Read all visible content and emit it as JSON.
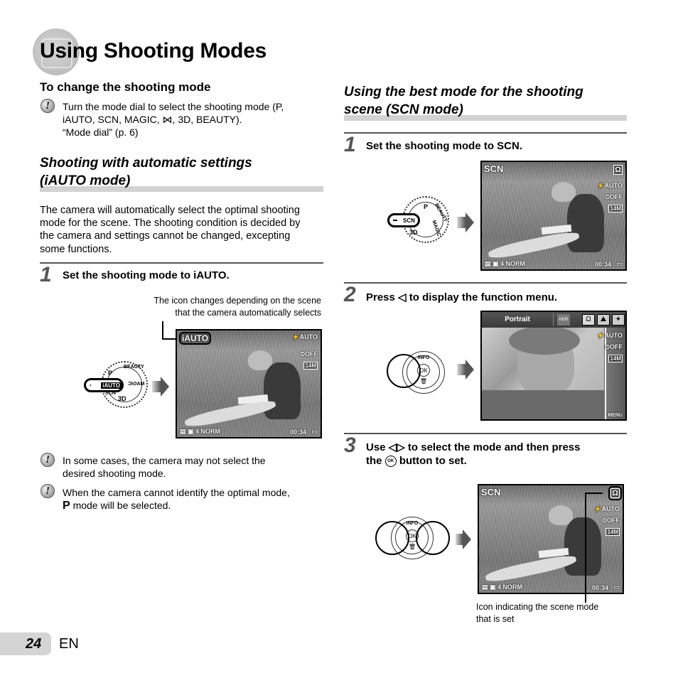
{
  "page": {
    "title": "Using Shooting Modes",
    "number": "24",
    "language": "EN"
  },
  "change_mode": {
    "heading": "To change the shooting mode",
    "note_line1": "Turn the mode dial to select the shooting mode (P,",
    "note_line2": "iAUTO, SCN, MAGIC, ⋈, 3D, BEAUTY).",
    "note_line3": "“Mode dial” (p. 6)"
  },
  "iauto_section": {
    "heading_line1": "Shooting with automatic settings",
    "heading_line2": "(iAUTO mode)",
    "body": [
      "The camera will automatically select the optimal shooting",
      "mode for the scene. The shooting condition is decided by",
      "the camera and settings cannot be changed, excepting",
      "some functions."
    ],
    "step1": {
      "number": "1",
      "text": "Set the shooting mode to iAUTO."
    },
    "callout_line1": "The icon changes depending on the scene",
    "callout_line2": "that the camera automatically selects",
    "dial": {
      "selected": "iAUTO",
      "labels": [
        "P",
        "BEAUTY",
        "MAGIC",
        "3D",
        "SCN"
      ]
    },
    "screen": {
      "mode_icon": "iAUTO",
      "flash": "⚡AUTO",
      "timer": "⏲OFF",
      "size": "14M",
      "bottom_left": "▤ ▣ 4 NORM",
      "time": "00:34",
      "battery": "▭"
    },
    "notes": [
      {
        "line1": "In some cases, the camera may not select the",
        "line2": "desired shooting mode."
      },
      {
        "line1": "When the camera cannot identify the optimal mode,",
        "line2": "mode will be selected.",
        "prefix": "P"
      }
    ]
  },
  "scn_section": {
    "heading_line1": "Using the best mode for the shooting",
    "heading_line2": "scene (SCN mode)",
    "step1": {
      "number": "1",
      "text": "Set the shooting mode to SCN."
    },
    "dial1": {
      "selected": "SCN",
      "labels": [
        "P",
        "BEAUTY",
        "MAGIC",
        "3D"
      ]
    },
    "screen1": {
      "mode_icon": "SCN",
      "scene_icon": "Ω",
      "flash": "⚡AUTO",
      "timer": "⏲OFF",
      "size": "14M",
      "bottom_left": "▤ ▣ 4 NORM",
      "time": "00:34",
      "battery": "▭"
    },
    "step2": {
      "number": "2",
      "text": "Press ◁ to display the function menu."
    },
    "dpad2": {
      "top": "INFO",
      "center": "OK",
      "bottom": "🗑"
    },
    "menu_screen": {
      "mode_label": "Portrait",
      "icons": [
        "HDR",
        "Ω",
        "⛰",
        "✦"
      ],
      "flash": "⚡AUTO",
      "timer": "⏲OFF",
      "size": "14M",
      "menu": "MENU"
    },
    "step3": {
      "number": "3",
      "line1": "Use ◁▷ to select the mode and then press",
      "line2_pre": "the",
      "ok": "OK",
      "line2_post": "button to set."
    },
    "dpad3": {
      "top": "INFO",
      "center": "OK",
      "bottom": "🗑"
    },
    "screen3": {
      "mode_icon": "SCN",
      "scene_icon": "Ω",
      "flash": "⚡AUTO",
      "timer": "⏲OFF",
      "size": "14M",
      "bottom_left": "▤ ▣ 4 NORM",
      "time": "00:34",
      "battery": "▭"
    },
    "callout_line1": "Icon indicating the scene mode",
    "callout_line2": "that is set"
  }
}
